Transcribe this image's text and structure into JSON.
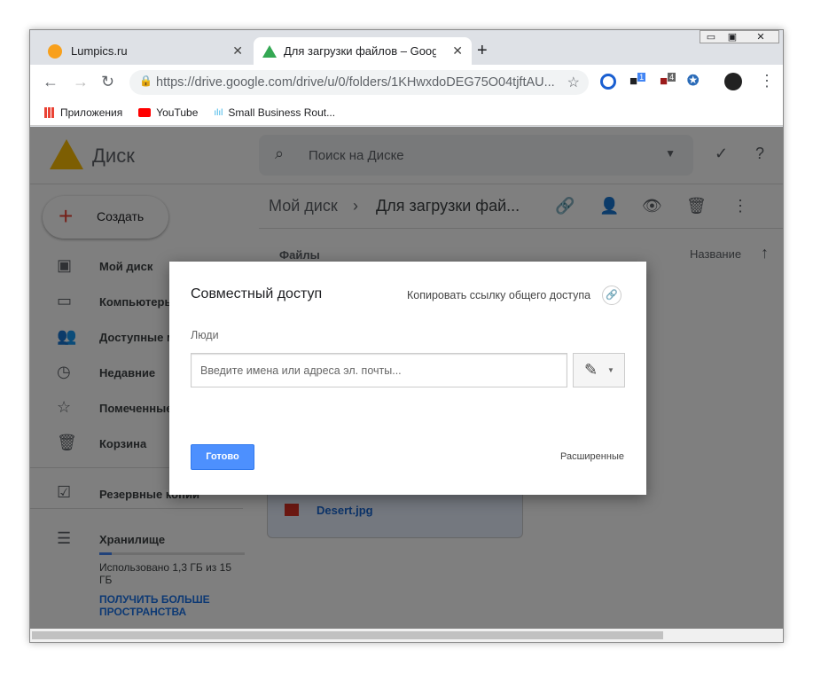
{
  "browser": {
    "tabs": [
      {
        "title": "Lumpics.ru",
        "icon": "orange-icon"
      },
      {
        "title": "Для загрузки файлов – Google Д",
        "icon": "drive-icon"
      }
    ],
    "url": "https://drive.google.com/drive/u/0/folders/1KHwxdoDEG75O04tjftAU...",
    "bookmarks": [
      "Приложения",
      "YouTube",
      "Small Business Rout..."
    ],
    "extension_badges": [
      "1",
      "4"
    ]
  },
  "drive": {
    "logo_text": "Диск",
    "search_placeholder": "Поиск на Диске",
    "create_label": "Создать",
    "nav": [
      {
        "label": "Мой диск",
        "icon": "my-drive-icon"
      },
      {
        "label": "Компьютеры",
        "icon": "computers-icon"
      },
      {
        "label": "Доступные мне",
        "icon": "shared-icon"
      },
      {
        "label": "Недавние",
        "icon": "clock-icon"
      },
      {
        "label": "Помеченные",
        "icon": "star-icon"
      },
      {
        "label": "Корзина",
        "icon": "trash-icon"
      }
    ],
    "backups": "Резервные копии",
    "storage": "Хранилище",
    "storage_used": "Использовано 1,3 ГБ из 15 ГБ",
    "storage_fraction": 0.087,
    "storage_upgrade": "ПОЛУЧИТЬ БОЛЬШЕ ПРОСТРАНСТВА",
    "breadcrumb": [
      "Мой диск",
      "Для загрузки фай..."
    ],
    "files_header": "Файлы",
    "sort_label": "Название",
    "file": "Desert.jpg"
  },
  "dialog": {
    "title": "Совместный доступ",
    "copy_link": "Копировать ссылку общего доступа",
    "people_label": "Люди",
    "input_placeholder": "Введите имена или адреса эл. почты...",
    "done": "Готово",
    "advanced": "Расширенные",
    "accent": "#4285f4"
  }
}
